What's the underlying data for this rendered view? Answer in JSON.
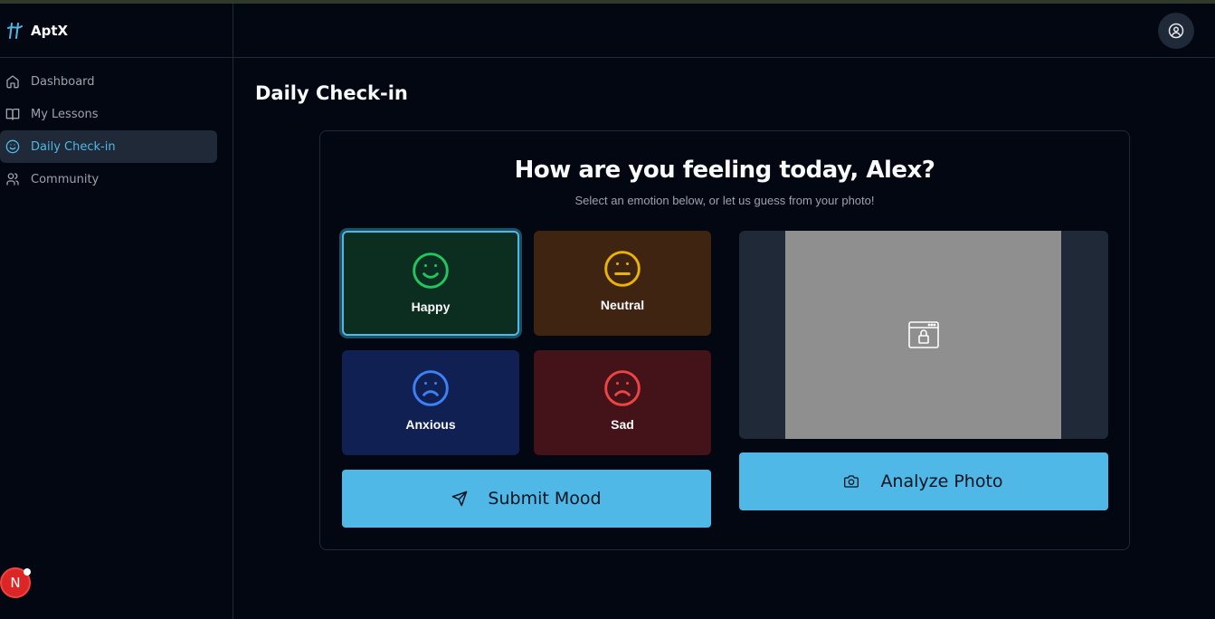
{
  "app": {
    "name": "AptX"
  },
  "sidebar": {
    "items": [
      {
        "label": "Dashboard",
        "icon": "home-icon"
      },
      {
        "label": "My Lessons",
        "icon": "book-icon"
      },
      {
        "label": "Daily Check-in",
        "icon": "smile-icon",
        "active": true
      },
      {
        "label": "Community",
        "icon": "users-icon"
      }
    ],
    "badge": "N"
  },
  "page": {
    "title": "Daily Check-in"
  },
  "checkin": {
    "heading": "How are you feeling today, Alex?",
    "subheading": "Select an emotion below, or let us guess from your photo!",
    "moods": [
      {
        "label": "Happy",
        "icon": "smile-face-icon",
        "color": "#22c55e",
        "selected": true
      },
      {
        "label": "Neutral",
        "icon": "neutral-face-icon",
        "color": "#eab308"
      },
      {
        "label": "Anxious",
        "icon": "frown-face-icon",
        "color": "#3b82f6"
      },
      {
        "label": "Sad",
        "icon": "frown-face-icon",
        "color": "#ef4444"
      }
    ],
    "submit_label": "Submit Mood",
    "analyze_label": "Analyze Photo"
  },
  "colors": {
    "accent": "#4fb8e6",
    "background": "#030712",
    "surface": "#1f2937"
  }
}
